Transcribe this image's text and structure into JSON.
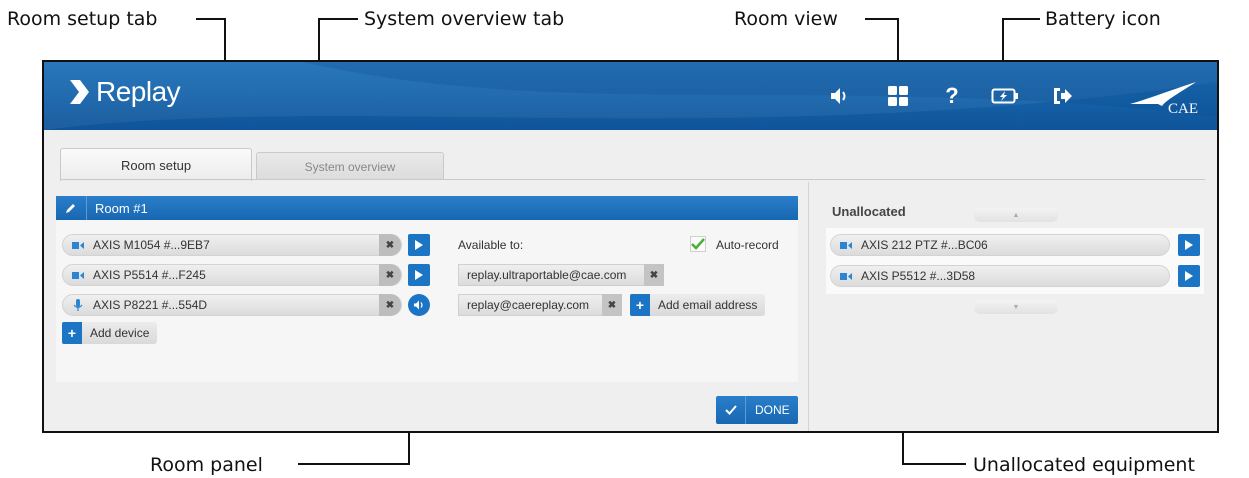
{
  "callouts": {
    "room_setup_tab": "Room setup tab",
    "system_overview_tab": "System overview tab",
    "room_view": "Room view",
    "battery_icon": "Battery icon",
    "room_panel": "Room panel",
    "unallocated_equipment": "Unallocated equipment"
  },
  "header": {
    "logo_text": "Replay",
    "brand_text": "CAE",
    "icons": [
      "volume-icon",
      "room-view-icon",
      "help-icon",
      "battery-icon",
      "logout-icon"
    ]
  },
  "tabs": [
    {
      "label": "Room setup",
      "active": true
    },
    {
      "label": "System overview",
      "active": false
    }
  ],
  "room": {
    "title": "Room #1",
    "devices": [
      {
        "name": "AXIS M1054 #...9EB7",
        "type": "camera",
        "action": "play"
      },
      {
        "name": "AXIS P5514 #...F245",
        "type": "camera",
        "action": "play"
      },
      {
        "name": "AXIS P8221 #...554D",
        "type": "microphone",
        "action": "audio"
      }
    ],
    "add_device_label": "Add device",
    "available_to_label": "Available to:",
    "auto_record_label": "Auto-record",
    "auto_record_checked": true,
    "emails": [
      "replay.ultraportable@cae.com",
      "replay@caereplay.com"
    ],
    "add_email_label": "Add email address",
    "done_label": "DONE"
  },
  "unallocated": {
    "title": "Unallocated",
    "devices": [
      {
        "name": "AXIS 212 PTZ #...BC06",
        "type": "camera"
      },
      {
        "name": "AXIS P5512 #...3D58",
        "type": "camera"
      }
    ]
  },
  "colors": {
    "header_blue": "#1461a8",
    "button_blue": "#1c74c4",
    "check_green": "#4caf3a"
  }
}
